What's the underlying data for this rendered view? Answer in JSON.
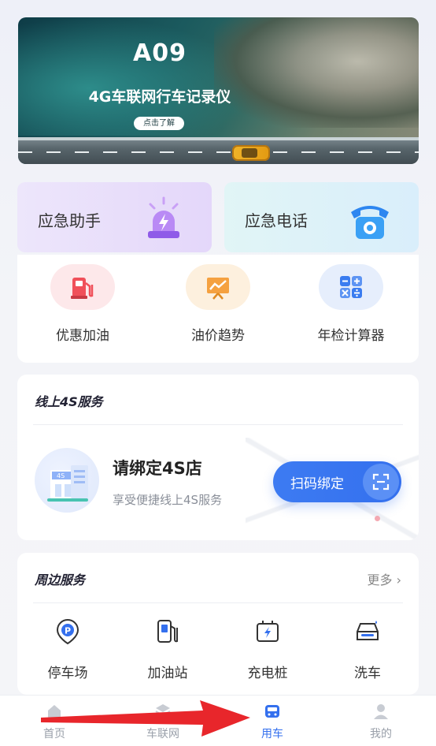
{
  "banner": {
    "title": "A09",
    "subtitle": "4G车联网行车记录仪",
    "cta": "点击了解"
  },
  "emergency": {
    "assist_label": "应急助手",
    "call_label": "应急电话"
  },
  "tools": [
    {
      "label": "优惠加油",
      "icon": "fuel-pump-icon",
      "color": "#f0505a"
    },
    {
      "label": "油价趋势",
      "icon": "trend-chart-icon",
      "color": "#f08a2a"
    },
    {
      "label": "年检计算器",
      "icon": "calculator-icon",
      "color": "#3a7cf0"
    }
  ],
  "service4s": {
    "title": "线上4S服务",
    "bind_title": "请绑定4S店",
    "bind_subtitle": "享受便捷线上4S服务",
    "scan_button": "扫码绑定",
    "store_badge": "4S"
  },
  "nearby": {
    "title": "周边服务",
    "more": "更多",
    "items": [
      {
        "label": "停车场",
        "icon": "parking-icon"
      },
      {
        "label": "加油站",
        "icon": "gas-station-icon"
      },
      {
        "label": "充电桩",
        "icon": "charging-pile-icon"
      },
      {
        "label": "洗车",
        "icon": "car-wash-icon"
      }
    ]
  },
  "bottom_nav": [
    {
      "label": "首页",
      "icon": "home-icon",
      "active": false
    },
    {
      "label": "车联网",
      "icon": "connected-car-icon",
      "active": false
    },
    {
      "label": "用车",
      "icon": "car-icon",
      "active": true
    },
    {
      "label": "我的",
      "icon": "profile-icon",
      "active": false
    }
  ],
  "colors": {
    "accent": "#3470ee",
    "annotation_arrow": "#e8262b"
  }
}
